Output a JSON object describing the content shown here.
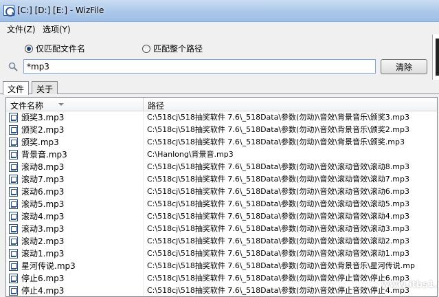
{
  "window": {
    "title": "[C:] [D:] [E:] - WizFile"
  },
  "menu": {
    "file": "文件(Z)",
    "options": "选项(Y)"
  },
  "search": {
    "mode_name": "仅匹配文件名",
    "mode_path": "匹配整个路径",
    "query": "*mp3",
    "clear_label": "清除"
  },
  "tabs": {
    "files": "文件",
    "about": "关于"
  },
  "table": {
    "columns": {
      "name": "文件名称",
      "path": "路径"
    },
    "rows": [
      {
        "name": "颁奖3.mp3",
        "path": "C:\\518cj\\518抽奖软件 7.6\\_518Data\\参数(勿动)\\音效\\背景音乐\\颁奖3.mp3"
      },
      {
        "name": "颁奖2.mp3",
        "path": "C:\\518cj\\518抽奖软件 7.6\\_518Data\\参数(勿动)\\音效\\背景音乐\\颁奖2.mp3"
      },
      {
        "name": "颁奖.mp3",
        "path": "C:\\518cj\\518抽奖软件 7.6\\_518Data\\参数(勿动)\\音效\\背景音乐\\颁奖.mp3"
      },
      {
        "name": "背景音.mp3",
        "path": "C:\\Hanlong\\背景音.mp3"
      },
      {
        "name": "滚动8.mp3",
        "path": "C:\\518cj\\518抽奖软件 7.6\\_518Data\\参数(勿动)\\音效\\滚动音效\\滚动8.mp3"
      },
      {
        "name": "滚动7.mp3",
        "path": "C:\\518cj\\518抽奖软件 7.6\\_518Data\\参数(勿动)\\音效\\滚动音效\\滚动7.mp3"
      },
      {
        "name": "滚动6.mp3",
        "path": "C:\\518cj\\518抽奖软件 7.6\\_518Data\\参数(勿动)\\音效\\滚动音效\\滚动6.mp3"
      },
      {
        "name": "滚动5.mp3",
        "path": "C:\\518cj\\518抽奖软件 7.6\\_518Data\\参数(勿动)\\音效\\滚动音效\\滚动5.mp3"
      },
      {
        "name": "滚动4.mp3",
        "path": "C:\\518cj\\518抽奖软件 7.6\\_518Data\\参数(勿动)\\音效\\滚动音效\\滚动4.mp3"
      },
      {
        "name": "滚动3.mp3",
        "path": "C:\\518cj\\518抽奖软件 7.6\\_518Data\\参数(勿动)\\音效\\滚动音效\\滚动3.mp3"
      },
      {
        "name": "滚动2.mp3",
        "path": "C:\\518cj\\518抽奖软件 7.6\\_518Data\\参数(勿动)\\音效\\滚动音效\\滚动2.mp3"
      },
      {
        "name": "滚动1.mp3",
        "path": "C:\\518cj\\518抽奖软件 7.6\\_518Data\\参数(勿动)\\音效\\滚动音效\\滚动1.mp3"
      },
      {
        "name": "星河传说.mp3",
        "path": "C:\\518cj\\518抽奖软件 7.6\\_518Data\\参数(勿动)\\音效\\背景音乐\\星河传说.mp"
      },
      {
        "name": "停止6.mp3",
        "path": "C:\\518cj\\518抽奖软件 7.6\\_518Data\\参数(勿动)\\音效\\停止音效\\停止6.mp3"
      },
      {
        "name": "停止4.mp3",
        "path": "C:\\518cj\\518抽奖软件 7.6\\_518Data\\参数(勿动)\\音效\\停止音效\\停止4.mp3"
      }
    ]
  },
  "watermark": "www.itbs1.net"
}
